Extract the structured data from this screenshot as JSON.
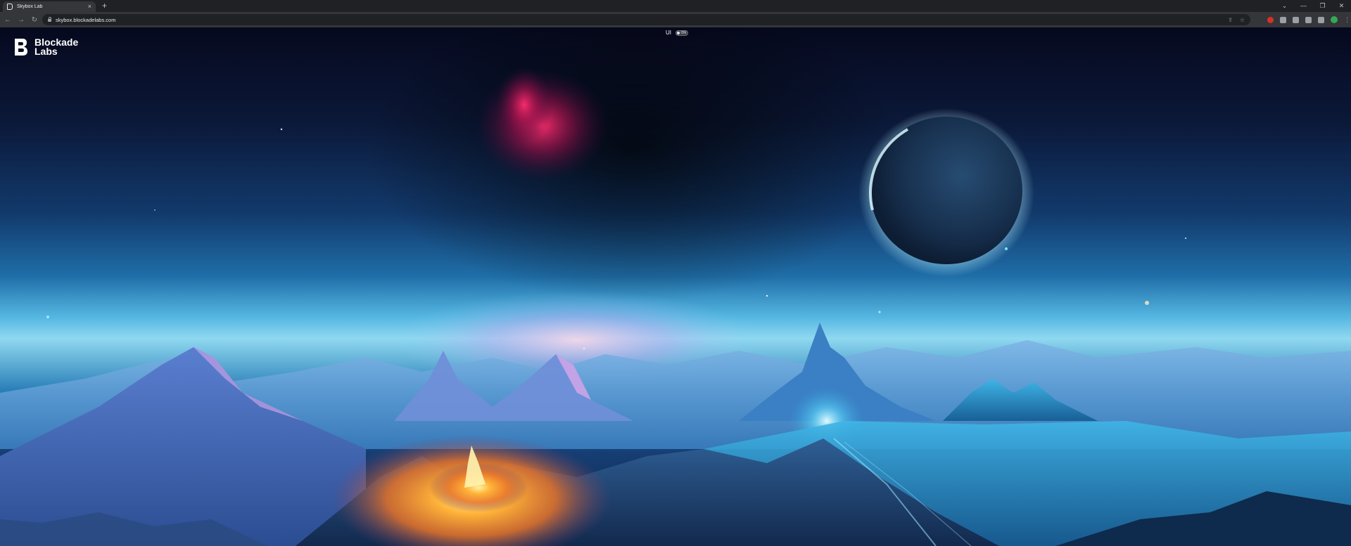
{
  "browser": {
    "tab_title": "Skybox Lab",
    "tab_close": "×",
    "new_tab": "+",
    "url": "skybox.blockadelabs.com",
    "nav": {
      "back": "←",
      "forward": "→",
      "reload": "↻"
    },
    "window": {
      "tabsearch": "⌄",
      "minimize": "—",
      "maximize": "❐",
      "close": "✕"
    },
    "omni_icons": {
      "share": "⇪",
      "bookmark": "☆"
    },
    "menu_dots": "⋮"
  },
  "app": {
    "logo_line1": "Blockade",
    "logo_line2": "Labs",
    "ui_label": "UI",
    "ui_toggle_state": "ON"
  },
  "colors": {
    "accent_green": "#34a853",
    "extension_red": "#d93025"
  }
}
